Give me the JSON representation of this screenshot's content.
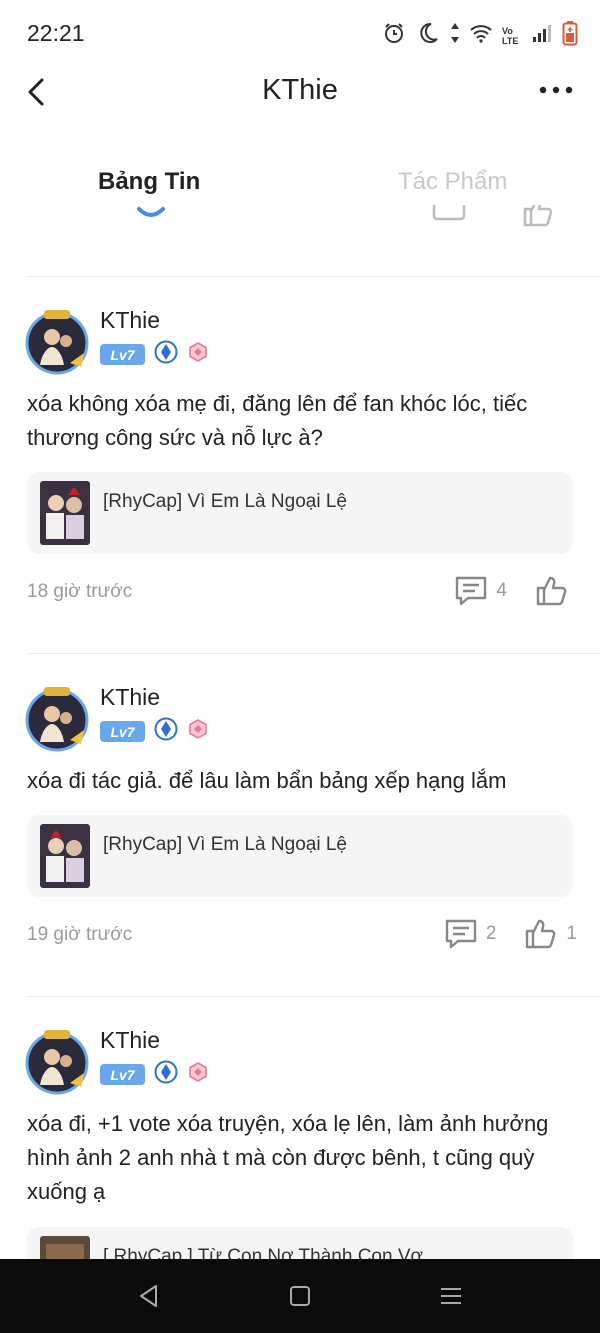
{
  "status": {
    "time": "22:21",
    "icons": [
      "alarm-icon",
      "moon-icon",
      "data-arrows-icon",
      "wifi-icon",
      "volte-icon",
      "signal-icon",
      "battery-low-icon"
    ],
    "volte_text": "Vo LTE"
  },
  "header": {
    "title": "KThie"
  },
  "tabs": [
    {
      "label": "Bảng Tin",
      "active": true
    },
    {
      "label": "Tác Phẩm",
      "active": false
    }
  ],
  "posts": [
    {
      "author": "KThie",
      "level": "Lv7",
      "text": "xóa không xóa mẹ đi, đăng lên để fan khóc lóc, tiếc thương công sức và nỗ lực à?",
      "card_title": "[RhyCap] Vì Em Là Ngoại Lệ",
      "time": "18 giờ trước",
      "comments": "4",
      "likes": ""
    },
    {
      "author": "KThie",
      "level": "Lv7",
      "text": "xóa đi tác giả. để lâu làm bẩn bảng xếp hạng lắm",
      "card_title": "[RhyCap] Vì Em Là Ngoại Lệ",
      "time": "19 giờ trước",
      "comments": "2",
      "likes": "1"
    },
    {
      "author": "KThie",
      "level": "Lv7",
      "text": "xóa đi, +1 vote xóa truyện, xóa lẹ lên, làm ảnh hưởng hình ảnh 2 anh nhà t mà còn được bênh, t cũng quỳ xuống ạ",
      "card_title": "[ RhyCap ] Từ Con Nợ Thành Con Vợ"
    }
  ],
  "colors": {
    "accent": "#3f8ee8",
    "level_badge": "#6aa6ea",
    "card_bg": "#f5f5f5",
    "muted": "#9a9a9a"
  }
}
